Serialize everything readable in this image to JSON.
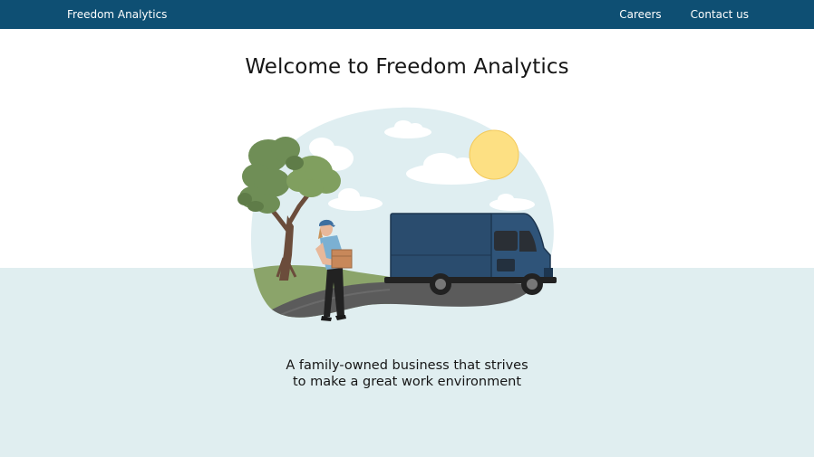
{
  "navbar": {
    "brand": "Freedom Analytics",
    "links": [
      {
        "label": "Careers"
      },
      {
        "label": "Contact us"
      }
    ]
  },
  "hero": {
    "title": "Welcome to Freedom Analytics",
    "tagline_line1": "A family-owned business that strives",
    "tagline_line2": "to make a great work environment"
  },
  "colors": {
    "navbar": "#0e4f73",
    "band": "#e0eef0",
    "van": "#2a4c6e",
    "sun": "#fde083"
  }
}
